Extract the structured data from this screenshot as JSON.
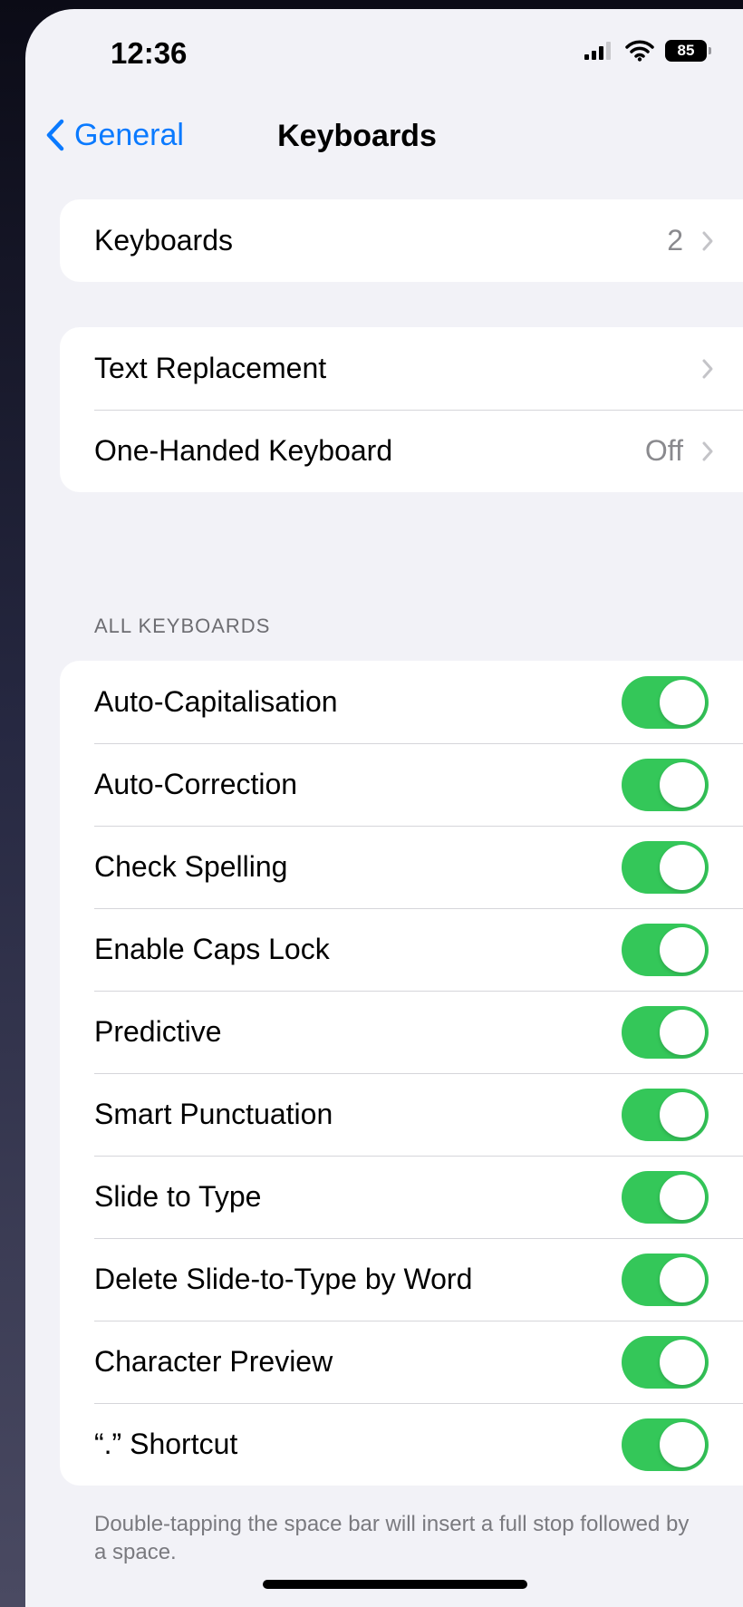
{
  "status_bar": {
    "time": "12:36",
    "battery": "85",
    "icons": [
      "signal-icon",
      "wifi-icon",
      "battery-icon"
    ]
  },
  "nav": {
    "back_label": "General",
    "title": "Keyboards"
  },
  "colors": {
    "accent": "#0a7aff",
    "toggle_on": "#34c759",
    "background": "#f2f2f7",
    "secondary_text": "#8a8a8e"
  },
  "keyboards_row": {
    "label": "Keyboards",
    "value": "2"
  },
  "text_group": [
    {
      "label": "Text Replacement",
      "value": ""
    },
    {
      "label": "One-Handed Keyboard",
      "value": "Off"
    }
  ],
  "all_keyboards": {
    "header": "ALL KEYBOARDS",
    "items": [
      {
        "label": "Auto-Capitalisation",
        "on": true
      },
      {
        "label": "Auto-Correction",
        "on": true
      },
      {
        "label": "Check Spelling",
        "on": true
      },
      {
        "label": "Enable Caps Lock",
        "on": true
      },
      {
        "label": "Predictive",
        "on": true
      },
      {
        "label": "Smart Punctuation",
        "on": true
      },
      {
        "label": "Slide to Type",
        "on": true
      },
      {
        "label": "Delete Slide-to-Type by Word",
        "on": true
      },
      {
        "label": "Character Preview",
        "on": true
      },
      {
        "label": "“.” Shortcut",
        "on": true
      }
    ],
    "footer": "Double-tapping the space bar will insert a full stop followed by a space."
  }
}
